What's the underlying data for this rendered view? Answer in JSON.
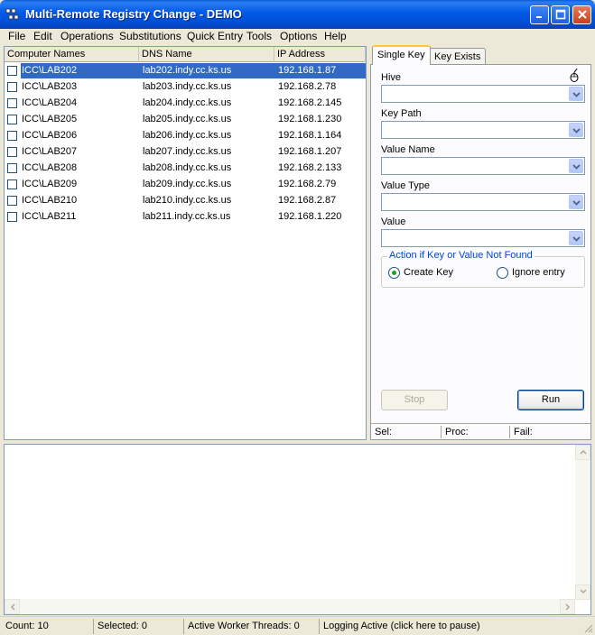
{
  "window": {
    "title": "Multi-Remote Registry Change - DEMO"
  },
  "menu": [
    "File",
    "Edit",
    "Operations",
    "Substitutions",
    "Quick Entry",
    "Tools",
    "Options",
    "Help"
  ],
  "list": {
    "columns": [
      "Computer Names",
      "DNS Name",
      "IP Address"
    ],
    "rows": [
      {
        "name": "ICC\\LAB202",
        "dns": "lab202.indy.cc.ks.us",
        "ip": "192.168.1.87",
        "selected": true
      },
      {
        "name": "ICC\\LAB203",
        "dns": "lab203.indy.cc.ks.us",
        "ip": "192.168.2.78"
      },
      {
        "name": "ICC\\LAB204",
        "dns": "lab204.indy.cc.ks.us",
        "ip": "192.168.2.145"
      },
      {
        "name": "ICC\\LAB205",
        "dns": "lab205.indy.cc.ks.us",
        "ip": "192.168.1.230"
      },
      {
        "name": "ICC\\LAB206",
        "dns": "lab206.indy.cc.ks.us",
        "ip": "192.168.1.164"
      },
      {
        "name": "ICC\\LAB207",
        "dns": "lab207.indy.cc.ks.us",
        "ip": "192.168.1.207"
      },
      {
        "name": "ICC\\LAB208",
        "dns": "lab208.indy.cc.ks.us",
        "ip": "192.168.2.133"
      },
      {
        "name": "ICC\\LAB209",
        "dns": "lab209.indy.cc.ks.us",
        "ip": "192.168.2.79"
      },
      {
        "name": "ICC\\LAB210",
        "dns": "lab210.indy.cc.ks.us",
        "ip": "192.168.2.87"
      },
      {
        "name": "ICC\\LAB211",
        "dns": "lab211.indy.cc.ks.us",
        "ip": "192.168.1.220"
      }
    ]
  },
  "tabs": {
    "single_key": "Single Key",
    "key_exists": "Key Exists"
  },
  "form": {
    "hive_label": "Hive",
    "hive_value": "",
    "key_path_label": "Key Path",
    "key_path_value": "",
    "value_name_label": "Value Name",
    "value_name_value": "",
    "value_type_label": "Value Type",
    "value_type_value": "",
    "value_label": "Value",
    "value_value": ""
  },
  "action_group": {
    "title": "Action if Key or Value Not Found",
    "create_key": "Create Key",
    "ignore_entry": "Ignore entry",
    "selected": "create_key"
  },
  "buttons": {
    "stop": "Stop",
    "run": "Run"
  },
  "panel_status": {
    "sel": "Sel:",
    "proc": "Proc:",
    "fail": "Fail:"
  },
  "statusbar": {
    "count": "Count: 10",
    "selected": "Selected: 0",
    "threads": "Active Worker Threads: 0",
    "logging": "Logging Active (click here to pause)"
  },
  "colors": {
    "selection": "#316ac5",
    "titlebar": "#0058e6",
    "radio_dot": "#21a121"
  }
}
